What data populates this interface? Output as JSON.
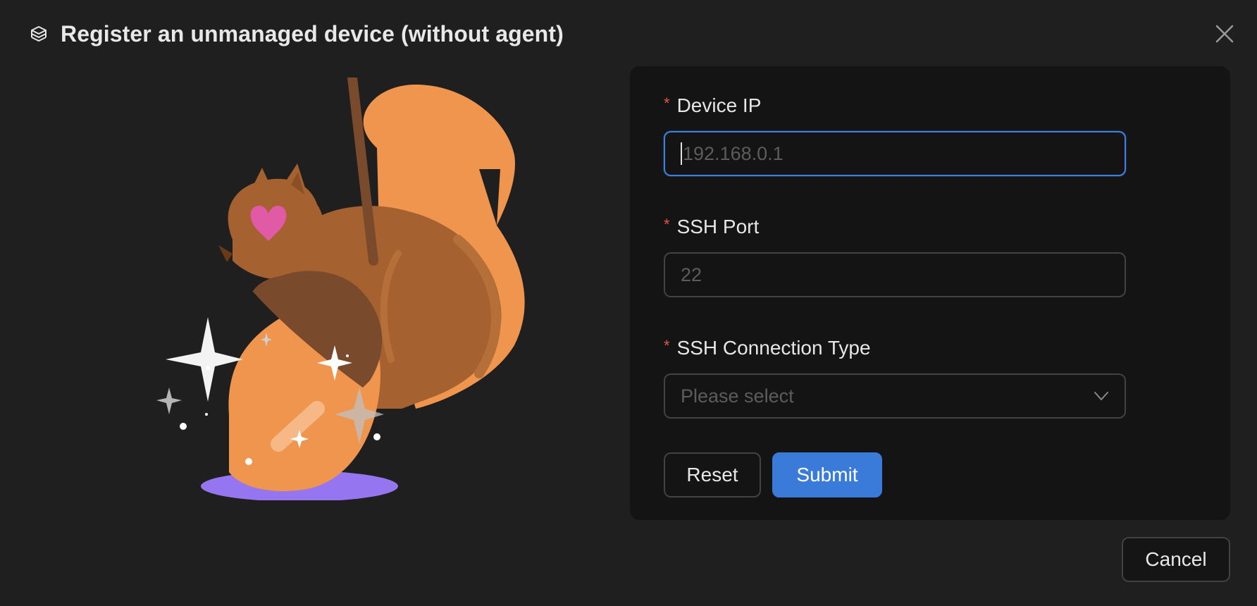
{
  "dialog": {
    "title": "Register an unmanaged device (without agent)",
    "header_icon": "cube-stack-icon",
    "close_icon": "close-icon"
  },
  "illustration": {
    "name": "squirrel-with-acorn-illustration"
  },
  "form": {
    "device_ip": {
      "label": "Device IP",
      "required_mark": "*",
      "placeholder": "192.168.0.1",
      "value": ""
    },
    "ssh_port": {
      "label": "SSH Port",
      "required_mark": "*",
      "placeholder": "22",
      "value": ""
    },
    "ssh_connection_type": {
      "label": "SSH Connection Type",
      "required_mark": "*",
      "placeholder": "Please select",
      "icon": "chevron-down-icon"
    },
    "reset_label": "Reset",
    "submit_label": "Submit"
  },
  "footer": {
    "cancel_label": "Cancel"
  },
  "colors": {
    "background": "#1f1f1f",
    "panel": "#141414",
    "accent": "#3a7bd9",
    "required": "#e8524a",
    "squirrel": "#f0954e"
  }
}
